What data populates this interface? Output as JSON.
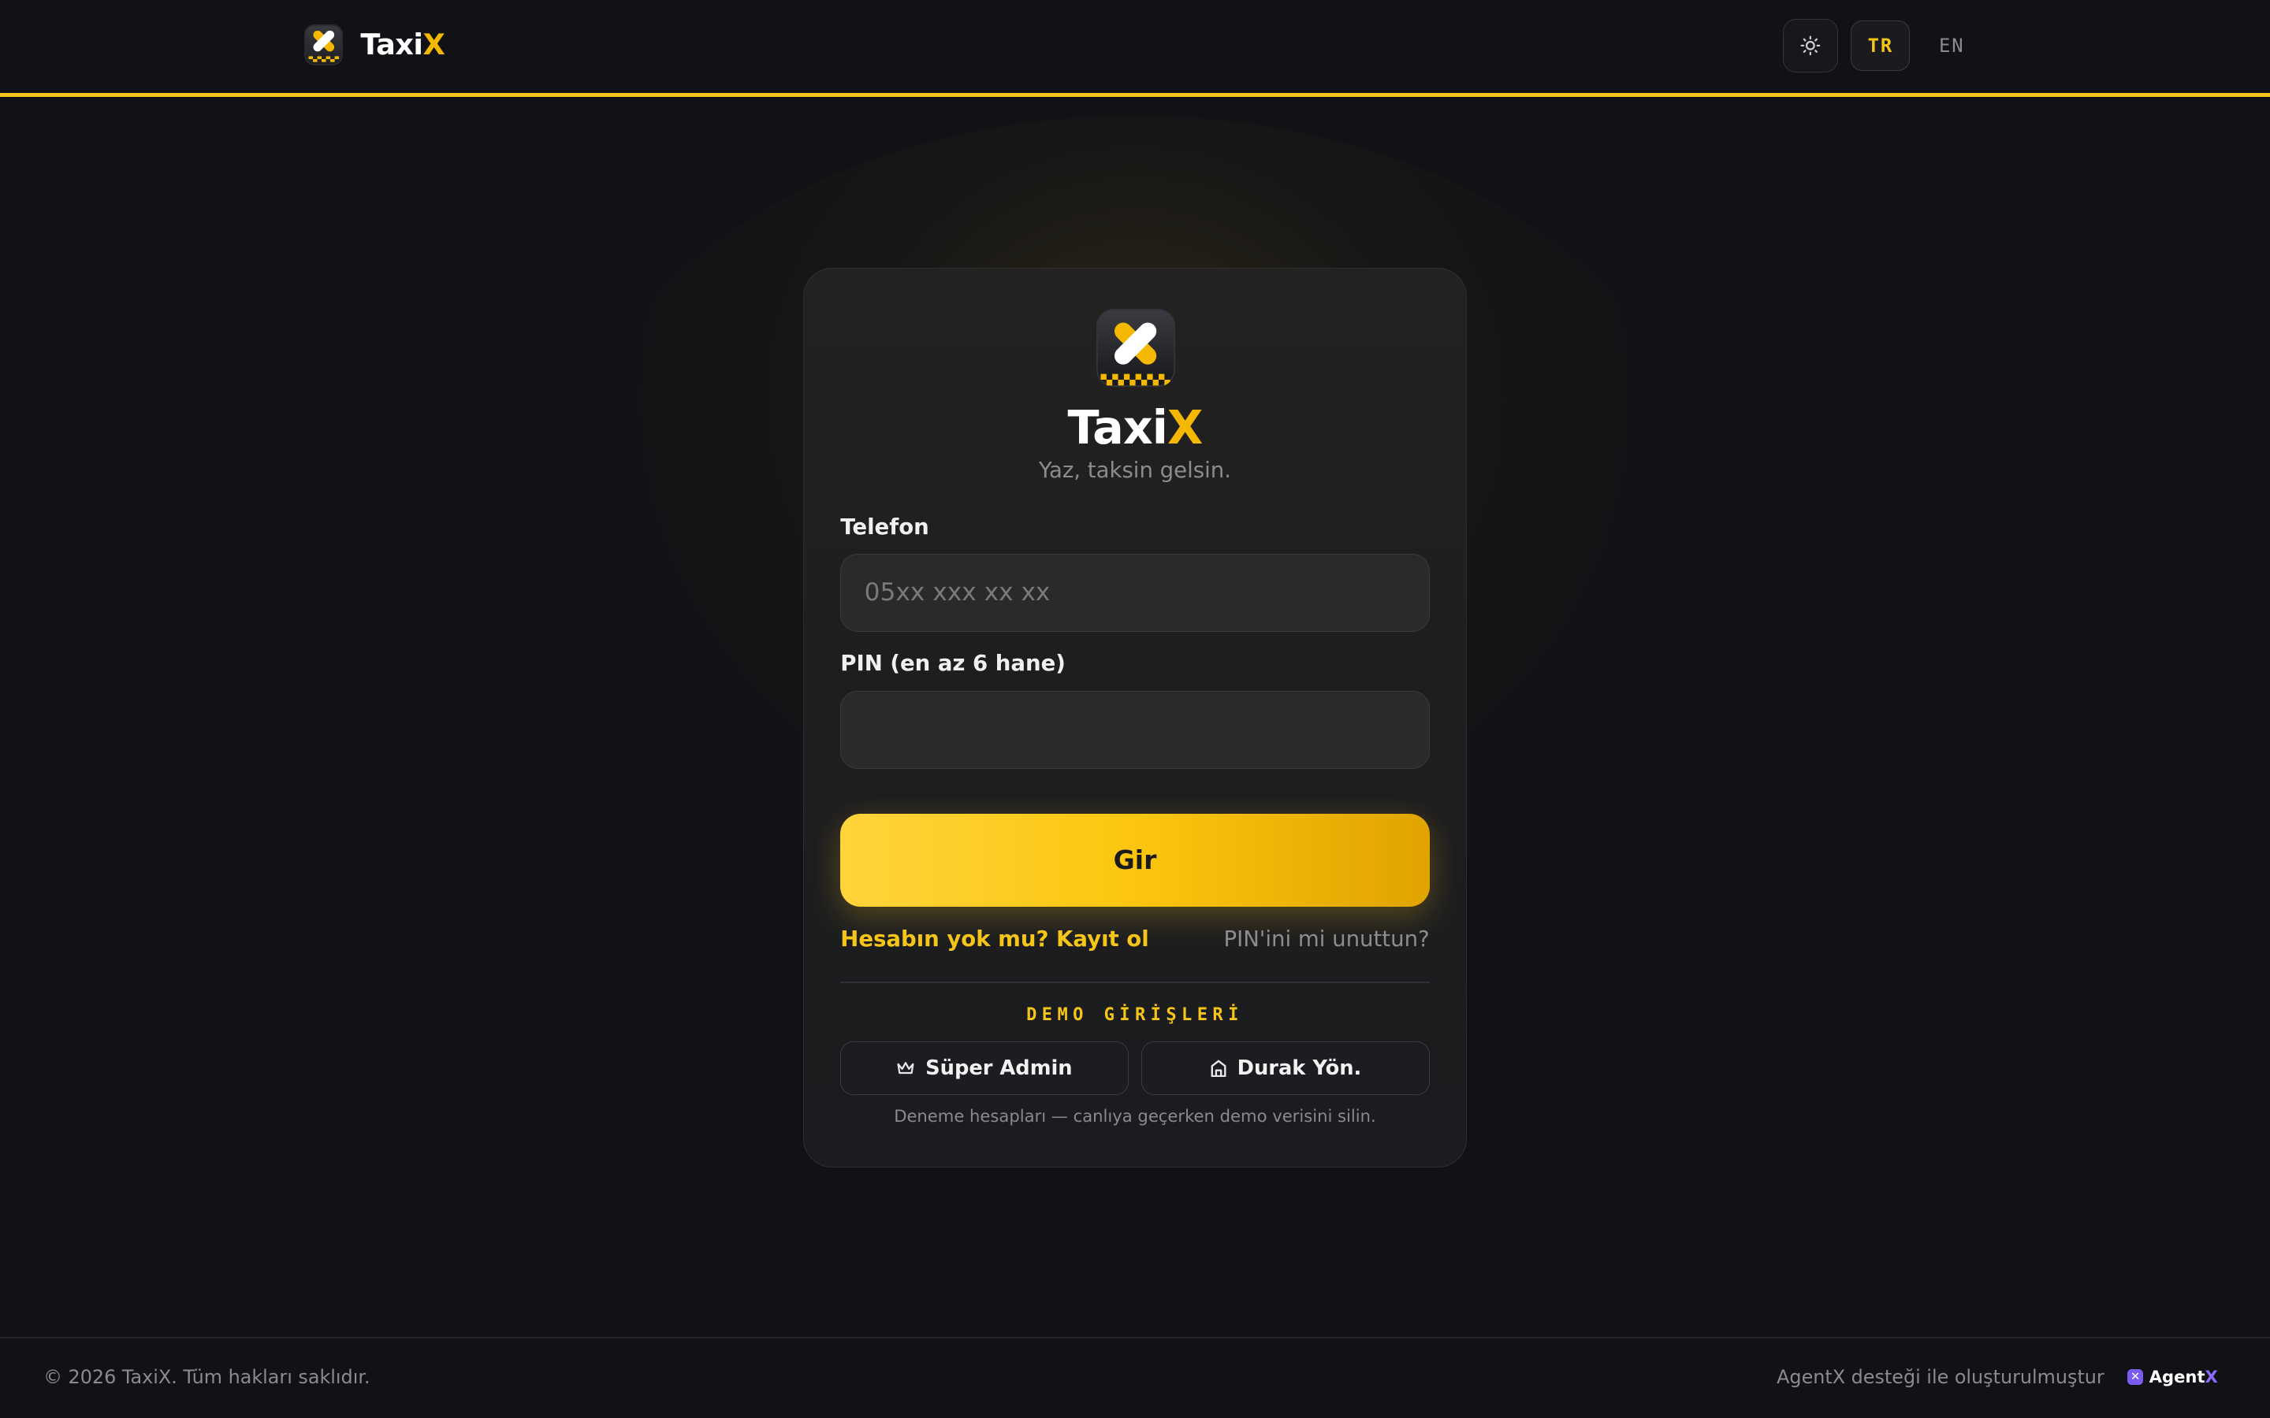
{
  "header": {
    "brand_main": "Taxi",
    "brand_accent": "X",
    "lang_active": "TR",
    "lang_other": "EN"
  },
  "card": {
    "title_main": "Taxi",
    "title_accent": "X",
    "subtitle": "Yaz, taksin gelsin.",
    "phone_label": "Telefon",
    "phone_placeholder": "05xx xxx xx xx",
    "phone_value": "",
    "pin_label": "PIN (en az 6 hane)",
    "pin_value": "",
    "submit_label": "Gir",
    "register_link": "Hesabın yok mu? Kayıt ol",
    "forgot_link": "PIN'ini mi unuttun?",
    "demo_title": "DEMO GİRİŞLERİ",
    "demo_buttons": [
      {
        "label": "Süper Admin",
        "icon": "crown-icon"
      },
      {
        "label": "Durak Yön.",
        "icon": "station-icon"
      }
    ],
    "demo_note": "Deneme hesapları — canlıya geçerken demo verisini silin."
  },
  "footer": {
    "copyright": "© 2026 TaxiX. Tüm hakları saklıdır.",
    "credit": "AgentX desteği ile oluşturulmuştur",
    "badge_main": "Agent",
    "badge_accent": "X"
  },
  "colors": {
    "accent": "#f5c518",
    "background": "#111216",
    "card": "#1e1e1f"
  }
}
